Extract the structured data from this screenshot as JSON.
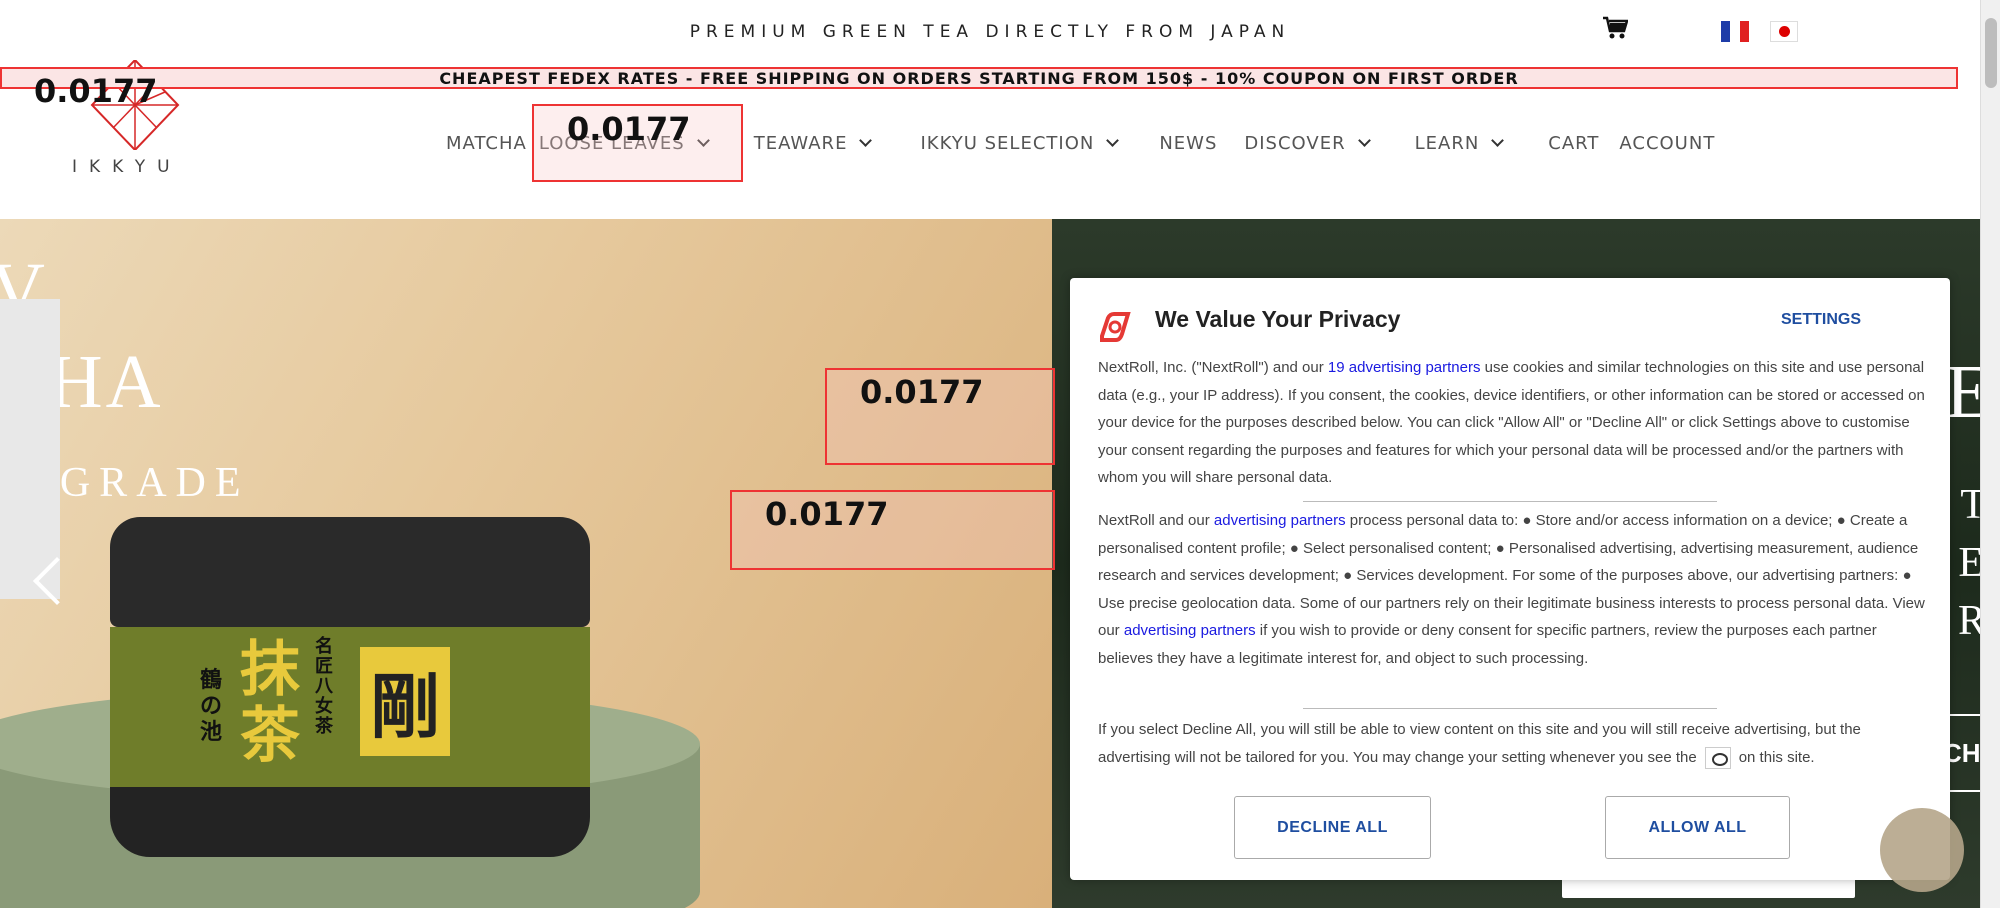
{
  "topbar": {
    "tagline": "PREMIUM GREEN TEA DIRECTLY FROM JAPAN",
    "cart_icon": "cart-icon",
    "flags": [
      "fr-flag",
      "jp-flag"
    ]
  },
  "banner": {
    "text": "CHEAPEST FEDEX RATES - FREE SHIPPING ON ORDERS STARTING FROM 150$ - 10% COUPON ON FIRST ORDER"
  },
  "logo": {
    "text": "IKKYU"
  },
  "nav": {
    "items": [
      {
        "label": "MATCHA"
      },
      {
        "label": "LOOSE LEAVES"
      },
      {
        "label": "TEAWARE"
      },
      {
        "label": "IKKYU SELECTION"
      },
      {
        "label": "NEWS"
      },
      {
        "label": "DISCOVER"
      },
      {
        "label": "LEARN"
      },
      {
        "label": "CART"
      },
      {
        "label": "ACCOUNT"
      }
    ]
  },
  "annotations": {
    "score_1": "0.0177",
    "score_2": "0.0177",
    "score_3": "0.0177",
    "score_4": "0.0177"
  },
  "hero": {
    "line1": "V",
    "line2": "CHA",
    "line3": "M GRADE",
    "kanji_1": "抹茶",
    "kanji_2": "剛",
    "kanji_3": "鶴の池",
    "kanji_4": "名匠八女茶",
    "right_edge": [
      "E",
      "T",
      "E",
      "R",
      "CH"
    ]
  },
  "modal": {
    "title": "We Value Your Privacy",
    "settings": "SETTINGS",
    "p1_a": "NextRoll, Inc. (\"NextRoll\") and our ",
    "p1_link": "19 advertising partners",
    "p1_b": " use cookies and similar technologies on this site and use personal data (e.g., your IP address). If you consent, the cookies, device identifiers, or other information can be stored or accessed on your device for the purposes described below. You can click \"Allow All\" or \"Decline All\" or click Settings above to customise your consent regarding the purposes and features for which your personal data will be processed and/or the partners with whom you will share personal data.",
    "p2_a": "NextRoll and our ",
    "p2_link": "advertising partners",
    "p2_b": " process personal data to: ● Store and/or access information on a device; ● Create a personalised content profile; ● Select personalised content; ● Personalised advertising, advertising measurement, audience research and services development; ● Services development. For some of the purposes above, our advertising partners: ● Use precise geolocation data. Some of our partners rely on their legitimate business interests to process personal data. View our ",
    "p2_link2": "advertising partners",
    "p2_c": " if you wish to provide or deny consent for specific partners, review the purposes each partner believes they have a legitimate interest for, and object to such processing.",
    "p3_a": "If you select Decline All, you will still be able to view content on this site and you will still receive advertising, but the advertising will not be tailored for you. You may change your setting whenever you see the",
    "p3_b": "on this site.",
    "decline": "DECLINE ALL",
    "allow": "ALLOW ALL"
  },
  "colors": {
    "accent_blue": "#1f4ea0",
    "link_blue": "#1a1ae0",
    "annotation_red": "#e33"
  }
}
